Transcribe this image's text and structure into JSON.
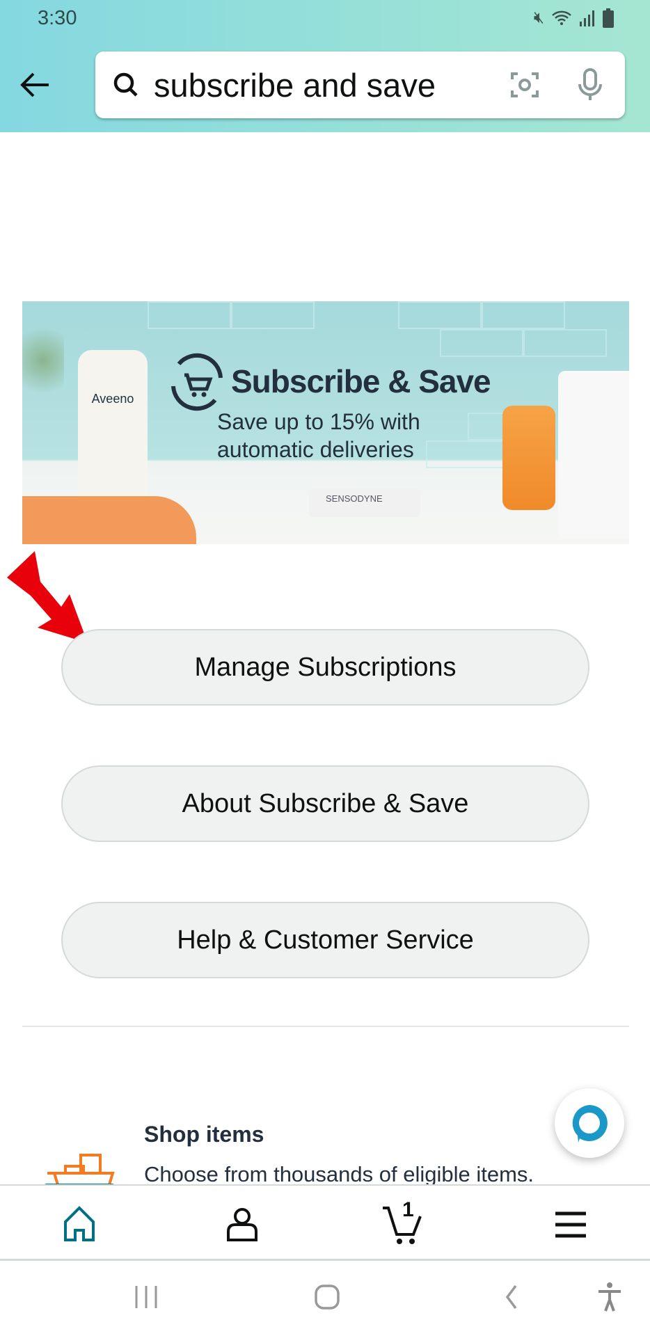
{
  "status_bar": {
    "time": "3:30",
    "icons": [
      "mute-icon",
      "wifi-icon",
      "signal-icon",
      "battery-icon"
    ]
  },
  "search": {
    "value": "subscribe and save",
    "icons": [
      "back-arrow-icon",
      "search-icon",
      "camera-scan-icon",
      "microphone-icon"
    ]
  },
  "banner": {
    "title": "Subscribe & Save",
    "subtitle_line1": "Save up to 15% with",
    "subtitle_line2": "automatic deliveries",
    "brands": [
      "Aveeno",
      "SENSODYNE"
    ]
  },
  "buttons": [
    {
      "label": "Manage Subscriptions"
    },
    {
      "label": "About Subscribe & Save"
    },
    {
      "label": "Help & Customer Service"
    }
  ],
  "annotation": {
    "color": "#e8000b"
  },
  "shop": {
    "title": "Shop items",
    "description": "Choose from thousands of eligible items."
  },
  "bottom_nav": {
    "items": [
      "home",
      "account",
      "cart",
      "menu"
    ],
    "cart_count": "1",
    "active": "home",
    "accent": "#007185"
  },
  "colors": {
    "alexa": "#1a98c7",
    "shop_icon": "#f47b20",
    "shop_icon_base": "#00818a"
  }
}
